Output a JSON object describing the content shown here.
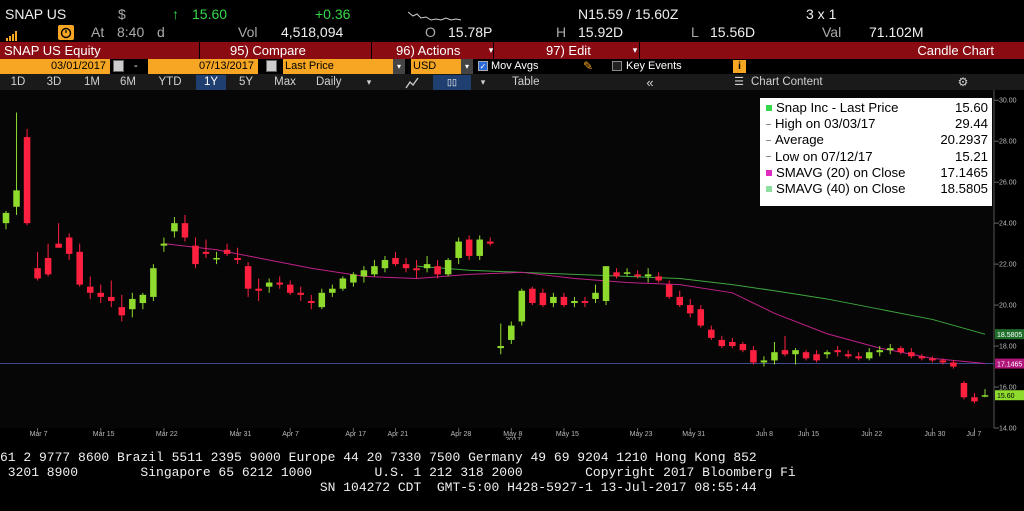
{
  "quote": {
    "ticker": "SNAP US",
    "currency_symbol": "$",
    "arrow": "↑",
    "price": "15.60",
    "change": "+0.36",
    "at_label": "At",
    "time": "8:40",
    "d_label": "d",
    "vol_label": "Vol",
    "volume": "4,518,094",
    "o_label": "O",
    "open": "15.78P",
    "h_label": "H",
    "high": "15.92D",
    "l_label": "L",
    "low": "15.56D",
    "val_label": "Val",
    "value": "71.102M",
    "bid_ask": "N15.59 / 15.60Z",
    "size": "3 x 1"
  },
  "commandbar": {
    "security": "SNAP US Equity",
    "compare": "95) Compare",
    "actions": "96) Actions",
    "edit": "97) Edit",
    "title": "Candle Chart"
  },
  "toolbar": {
    "start_date": "03/01/2017",
    "dash": "-",
    "end_date": "07/13/2017",
    "field": "Last Price",
    "currency": "USD",
    "mov_avgs": "Mov Avgs",
    "key_events": "Key Events"
  },
  "tabs": [
    {
      "label": "1D"
    },
    {
      "label": "3D"
    },
    {
      "label": "1M"
    },
    {
      "label": "6M"
    },
    {
      "label": "YTD"
    },
    {
      "label": "1Y"
    },
    {
      "label": "5Y"
    },
    {
      "label": "Max"
    },
    {
      "label": "Daily"
    }
  ],
  "table_label": "Table",
  "chart_content_label": "Chart Content",
  "legend": {
    "rows": [
      {
        "label": "Snap Inc - Last Price",
        "value": "15.60",
        "color": "#35d84a"
      },
      {
        "label": "High on 03/03/17",
        "value": "29.44",
        "color": "#999999"
      },
      {
        "label": "Average",
        "value": "20.2937",
        "color": "#999999"
      },
      {
        "label": "Low on 07/12/17",
        "value": "15.21",
        "color": "#999999"
      },
      {
        "label": "SMAVG (20) on Close",
        "value": "17.1465",
        "color": "#e02ac0"
      },
      {
        "label": "SMAVG (40) on Close",
        "value": "18.5805",
        "color": "#8fe0a0"
      }
    ]
  },
  "footer": {
    "line1": "61 2 9777 8600 Brazil 5511 2395 9000 Europe 44 20 7330 7500 Germany 49 69 9204 1210 Hong Kong 852",
    "line2": " 3201 8900        Singapore 65 6212 1000        U.S. 1 212 318 2000        Copyright 2017 Bloomberg Fi",
    "line3": "                                         SN 104272 CDT  GMT-5:00 H428-5927-1 13-Jul-2017 08:55:44"
  },
  "chart_data": {
    "type": "candlestick",
    "ylim": [
      14,
      30.5
    ],
    "yticks": [
      "30.00",
      "28.00",
      "26.00",
      "24.00",
      "22.00",
      "20.00",
      "18.00",
      "16.00",
      "14.00"
    ],
    "yvalues": [
      30,
      28,
      26,
      24,
      22,
      20,
      18,
      16,
      14
    ],
    "xticks": [
      "Mar 7",
      "Mar 15",
      "Mar 22",
      "Mar 31",
      "Apr 7",
      "Apr 17",
      "Apr 21",
      "Apr 28",
      "May 8",
      "May 15",
      "May 23",
      "May 31",
      "Jun 8",
      "Jun 15",
      "Jun 22",
      "Jun 30",
      "Jul 7"
    ],
    "xtick_sub": "2017",
    "sma40_label": "18.5805",
    "sma20_label": "17.1465",
    "last_label": "15.60",
    "sma40_color": "#3fa63f",
    "sma20_color": "#c0208a",
    "up_color": "#8edb2e",
    "down_color": "#ff2040",
    "candles": [
      [
        24.0,
        24.6,
        23.7,
        24.5
      ],
      [
        24.8,
        29.4,
        24.4,
        25.6
      ],
      [
        28.2,
        28.6,
        23.9,
        24.0
      ],
      [
        21.8,
        22.6,
        21.2,
        21.3
      ],
      [
        22.3,
        23.0,
        21.4,
        21.5
      ],
      [
        23.0,
        24.0,
        22.8,
        22.8
      ],
      [
        23.3,
        23.5,
        22.2,
        22.5
      ],
      [
        22.6,
        23.0,
        20.9,
        21.0
      ],
      [
        20.9,
        21.4,
        20.3,
        20.6
      ],
      [
        20.6,
        21.0,
        20.1,
        20.4
      ],
      [
        20.4,
        21.2,
        19.9,
        20.2
      ],
      [
        19.9,
        20.5,
        19.2,
        19.5
      ],
      [
        19.8,
        20.6,
        19.4,
        20.3
      ],
      [
        20.1,
        20.6,
        19.8,
        20.5
      ],
      [
        20.4,
        22.0,
        20.2,
        21.8
      ],
      [
        22.9,
        23.3,
        22.6,
        23.0
      ],
      [
        23.6,
        24.3,
        23.3,
        24.0
      ],
      [
        24.0,
        24.4,
        23.1,
        23.3
      ],
      [
        22.9,
        23.3,
        21.8,
        22.0
      ],
      [
        22.6,
        23.2,
        22.3,
        22.5
      ],
      [
        22.3,
        22.6,
        22.0,
        22.3
      ],
      [
        22.7,
        23.0,
        22.4,
        22.5
      ],
      [
        22.3,
        22.8,
        22.0,
        22.2
      ],
      [
        21.9,
        22.1,
        20.4,
        20.8
      ],
      [
        20.8,
        21.3,
        20.2,
        20.7
      ],
      [
        20.9,
        21.3,
        20.6,
        21.1
      ],
      [
        21.1,
        21.4,
        20.8,
        21.0
      ],
      [
        21.0,
        21.2,
        20.5,
        20.6
      ],
      [
        20.6,
        20.9,
        20.2,
        20.5
      ],
      [
        20.2,
        20.5,
        19.8,
        20.1
      ],
      [
        19.9,
        20.8,
        19.8,
        20.6
      ],
      [
        20.6,
        21.0,
        20.4,
        20.8
      ],
      [
        20.8,
        21.4,
        20.7,
        21.3
      ],
      [
        21.1,
        21.6,
        20.9,
        21.5
      ],
      [
        21.4,
        21.9,
        21.1,
        21.7
      ],
      [
        21.5,
        22.2,
        21.4,
        21.9
      ],
      [
        21.8,
        22.4,
        21.6,
        22.2
      ],
      [
        22.3,
        22.6,
        21.9,
        22.0
      ],
      [
        22.0,
        22.3,
        21.6,
        21.8
      ],
      [
        21.8,
        22.2,
        21.3,
        21.7
      ],
      [
        21.8,
        22.4,
        21.6,
        22.0
      ],
      [
        21.9,
        22.2,
        21.3,
        21.5
      ],
      [
        21.5,
        22.3,
        21.4,
        22.2
      ],
      [
        22.3,
        23.3,
        22.0,
        23.1
      ],
      [
        23.2,
        23.4,
        22.2,
        22.4
      ],
      [
        22.4,
        23.4,
        22.2,
        23.2
      ],
      [
        23.1,
        23.3,
        22.9,
        23.0
      ],
      [
        17.9,
        19.1,
        17.6,
        18.0
      ],
      [
        18.3,
        19.2,
        18.1,
        19.0
      ],
      [
        19.2,
        20.8,
        19.0,
        20.7
      ],
      [
        20.8,
        20.9,
        20.0,
        20.1
      ],
      [
        20.6,
        20.8,
        19.9,
        20.0
      ],
      [
        20.1,
        20.6,
        19.9,
        20.4
      ],
      [
        20.4,
        20.6,
        19.9,
        20.0
      ],
      [
        20.1,
        20.4,
        19.9,
        20.2
      ],
      [
        20.2,
        20.4,
        19.9,
        20.1
      ],
      [
        20.3,
        21.0,
        20.1,
        20.6
      ],
      [
        20.2,
        21.9,
        20.0,
        21.9
      ],
      [
        21.6,
        21.8,
        21.3,
        21.4
      ],
      [
        21.6,
        21.8,
        21.4,
        21.6
      ],
      [
        21.5,
        21.7,
        21.3,
        21.4
      ],
      [
        21.4,
        21.8,
        21.1,
        21.5
      ],
      [
        21.4,
        21.6,
        21.1,
        21.2
      ],
      [
        21.0,
        21.2,
        20.3,
        20.4
      ],
      [
        20.4,
        20.7,
        19.9,
        20.0
      ],
      [
        20.0,
        20.3,
        19.4,
        19.6
      ],
      [
        19.8,
        20.0,
        18.9,
        19.0
      ],
      [
        18.8,
        19.0,
        18.3,
        18.4
      ],
      [
        18.3,
        18.5,
        17.9,
        18.0
      ],
      [
        18.2,
        18.4,
        17.9,
        18.0
      ],
      [
        18.1,
        18.2,
        17.7,
        17.8
      ],
      [
        17.8,
        18.0,
        17.1,
        17.2
      ],
      [
        17.2,
        17.5,
        17.0,
        17.3
      ],
      [
        17.3,
        18.2,
        17.1,
        17.7
      ],
      [
        17.8,
        18.5,
        17.5,
        17.6
      ],
      [
        17.6,
        17.9,
        17.1,
        17.8
      ],
      [
        17.7,
        17.8,
        17.3,
        17.4
      ],
      [
        17.6,
        17.8,
        17.2,
        17.3
      ],
      [
        17.6,
        17.8,
        17.4,
        17.7
      ],
      [
        17.8,
        18.0,
        17.5,
        17.7
      ],
      [
        17.6,
        17.8,
        17.4,
        17.5
      ],
      [
        17.5,
        17.7,
        17.3,
        17.4
      ],
      [
        17.4,
        17.9,
        17.3,
        17.7
      ],
      [
        17.7,
        18.0,
        17.5,
        17.8
      ],
      [
        17.8,
        18.1,
        17.6,
        17.9
      ],
      [
        17.9,
        18.0,
        17.6,
        17.7
      ],
      [
        17.7,
        17.9,
        17.4,
        17.5
      ],
      [
        17.5,
        17.6,
        17.3,
        17.4
      ],
      [
        17.4,
        17.5,
        17.2,
        17.3
      ],
      [
        17.3,
        17.4,
        17.1,
        17.2
      ],
      [
        17.2,
        17.3,
        16.9,
        17.0
      ],
      [
        16.2,
        16.3,
        15.4,
        15.5
      ],
      [
        15.5,
        15.7,
        15.2,
        15.3
      ],
      [
        15.6,
        15.9,
        15.5,
        15.6
      ]
    ],
    "sma20": [
      [
        15,
        23.0
      ],
      [
        20,
        22.7
      ],
      [
        25,
        22.3
      ],
      [
        30,
        21.8
      ],
      [
        35,
        21.4
      ],
      [
        40,
        21.3
      ],
      [
        45,
        21.5
      ],
      [
        50,
        21.6
      ],
      [
        55,
        21.3
      ],
      [
        60,
        21.1
      ],
      [
        65,
        21.0
      ],
      [
        70,
        20.6
      ],
      [
        75,
        19.6
      ],
      [
        80,
        18.6
      ],
      [
        85,
        17.9
      ],
      [
        90,
        17.4
      ],
      [
        95,
        17.15
      ]
    ],
    "sma40": [
      [
        40,
        21.9
      ],
      [
        45,
        21.7
      ],
      [
        50,
        21.6
      ],
      [
        55,
        21.5
      ],
      [
        60,
        21.4
      ],
      [
        65,
        21.3
      ],
      [
        70,
        21.0
      ],
      [
        75,
        20.7
      ],
      [
        80,
        20.3
      ],
      [
        85,
        19.8
      ],
      [
        90,
        19.3
      ],
      [
        95,
        18.58
      ]
    ],
    "ref_line": 17.1465
  }
}
